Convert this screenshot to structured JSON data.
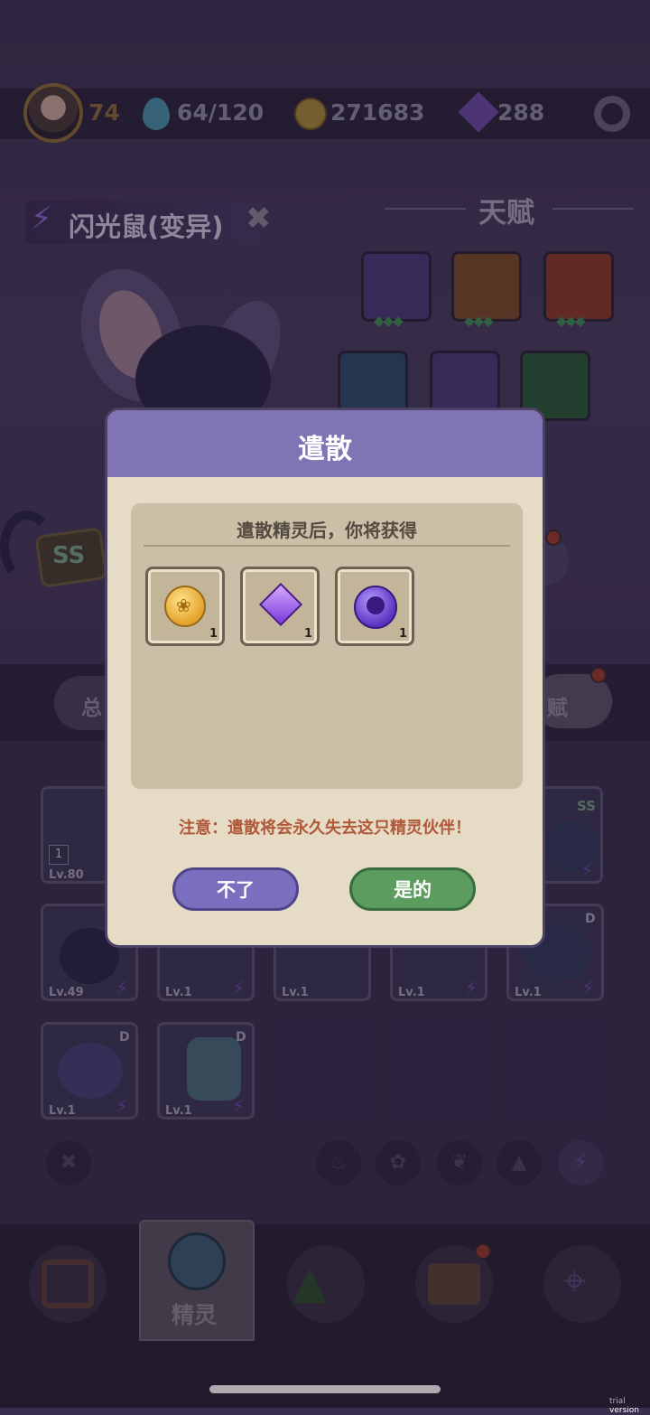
{
  "stats": {
    "level": "74",
    "stamina": "64/120",
    "coins": "271683",
    "gems": "288"
  },
  "creature": {
    "name": "闪光鼠(变异)",
    "rank": "SS"
  },
  "talents": {
    "title": "天赋"
  },
  "tabs": {
    "left_label": "总",
    "right_label": "赋"
  },
  "cards": [
    {
      "level": "Lv.80",
      "count": "1"
    },
    {
      "level": "Lv.49"
    },
    {
      "level": "Lv.1"
    },
    {
      "level": "Lv.1"
    },
    {
      "level": "Lv.1"
    },
    {
      "level": "Lv.1"
    },
    {
      "level": "Lv.1"
    },
    {
      "level": "Lv.1"
    }
  ],
  "card_badges": {
    "ss": "SS",
    "d": "D"
  },
  "nav": {
    "active_label": "精灵"
  },
  "dialog": {
    "title": "遣散",
    "caption": "遣散精灵后，你将获得",
    "rewards": [
      {
        "icon": "coin-icon",
        "qty": "1"
      },
      {
        "icon": "gem-icon",
        "qty": "1"
      },
      {
        "icon": "spirit-orb-icon",
        "qty": "1"
      }
    ],
    "warning": "注意：遣散将会永久失去这只精灵伙伴！",
    "cancel_label": "不了",
    "confirm_label": "是的"
  },
  "watermark": "trial version",
  "colors": {
    "dialog_header": "#7f74b4",
    "dialog_body": "#e6dcc6",
    "cancel_button": "#7a6fbf",
    "confirm_button": "#5c9c5e",
    "warning_text": "#b0583a"
  }
}
